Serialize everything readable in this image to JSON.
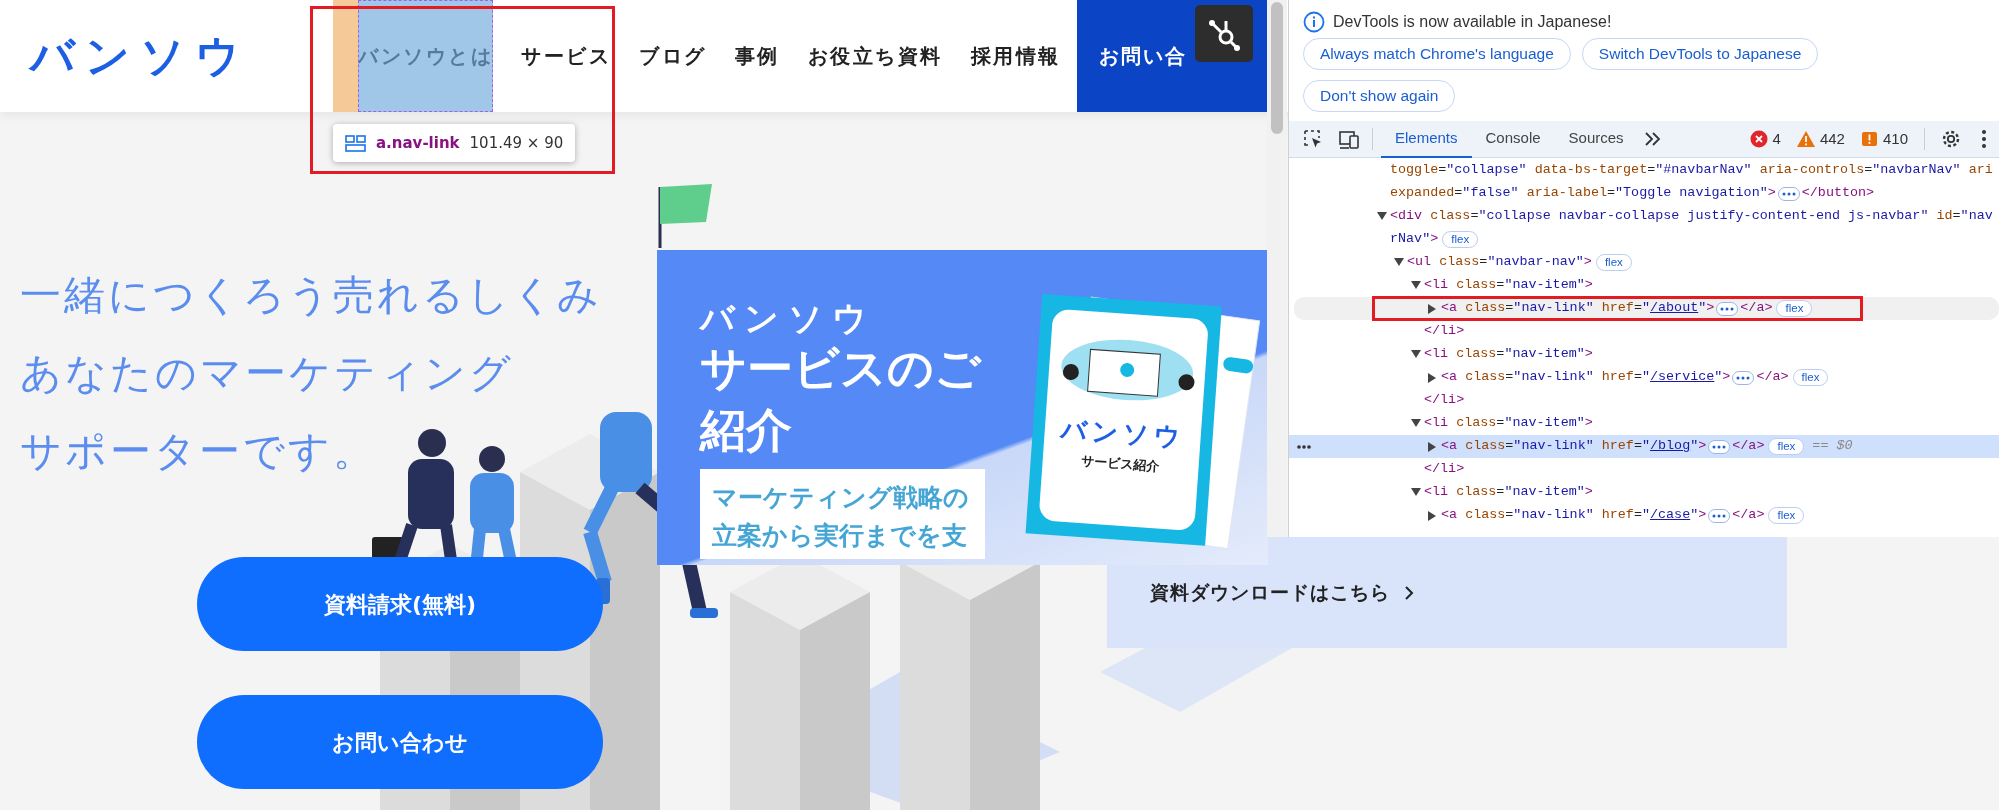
{
  "header": {
    "logo": "バンソウ",
    "nav": [
      {
        "label": "バンソウとは",
        "inspected": true
      },
      {
        "label": "サービス",
        "inspected": false
      },
      {
        "label": "ブログ",
        "inspected": false
      },
      {
        "label": "事例",
        "inspected": false
      },
      {
        "label": "お役立ち資料",
        "inspected": false
      },
      {
        "label": "採用情報",
        "inspected": false
      }
    ],
    "contact_button": "お問い合",
    "inspector_tooltip": {
      "selector": "a.nav-link",
      "size": "101.49 × 90"
    }
  },
  "hero": {
    "headline": [
      "一緒につくろう売れるしくみ",
      "あなたのマーケティング",
      "サポーターです。"
    ],
    "buttons": [
      "資料請求(無料)",
      "お問い合わせ"
    ]
  },
  "promo": {
    "brand": "バンソウ",
    "title": [
      "サービスのご",
      "紹介"
    ],
    "lead": [
      "マーケティング戦略の",
      "立案から実行までを支"
    ],
    "brochure": {
      "brand": "バンソウ",
      "title": "サービス紹介"
    },
    "download_link": "資料ダウンロードはこちら"
  },
  "devtools": {
    "notice": "DevTools is now available in Japanese!",
    "notice_buttons": [
      "Always match Chrome's language",
      "Switch DevTools to Japanese",
      "Don't show again"
    ],
    "tabs": [
      {
        "label": "Elements",
        "selected": true
      },
      {
        "label": "Console",
        "selected": false
      },
      {
        "label": "Sources",
        "selected": false
      }
    ],
    "errors": "4",
    "warnings": "442",
    "issues": "410",
    "dom": [
      {
        "kind": "continuation",
        "lines": [
          "toggle=\"collapse\" data-bs-target=\"#navbarNav\" aria-controls=\"navbarNav\" ari",
          "expanded=\"false\" aria-label=\"Toggle navigation\">"
        ],
        "expanded": false,
        "close": "</button>"
      },
      {
        "kind": "element",
        "lines": [
          "<div class=\"collapse navbar-collapse justify-content-end js-navbar\" id=\"nav",
          "rNav\">"
        ],
        "expanded": true,
        "badge": "flex",
        "children": [
          {
            "kind": "element",
            "lines": [
              "<ul class=\"navbar-nav\">"
            ],
            "expanded": true,
            "badge": "flex",
            "children": [
              {
                "kind": "element",
                "lines": [
                  "<li class=\"nav-item\">"
                ],
                "expanded": true,
                "close": "</li>",
                "children": [
                  {
                    "kind": "link",
                    "before": "<a class=\"nav-link\" href=\"",
                    "link": "/about",
                    "after": "\">",
                    "expanded": false,
                    "close": "</a>",
                    "badge": "flex",
                    "hovered": true,
                    "selected": false,
                    "annotated": true
                  }
                ]
              },
              {
                "kind": "element",
                "lines": [
                  "<li class=\"nav-item\">"
                ],
                "expanded": true,
                "close": "</li>",
                "children": [
                  {
                    "kind": "link",
                    "before": "<a class=\"nav-link\" href=\"",
                    "link": "/service",
                    "after": "\">",
                    "expanded": false,
                    "close": "</a>",
                    "badge": "flex",
                    "hovered": false,
                    "selected": false,
                    "annotated": false
                  }
                ]
              },
              {
                "kind": "element",
                "lines": [
                  "<li class=\"nav-item\">"
                ],
                "expanded": true,
                "close": "</li>",
                "children": [
                  {
                    "kind": "link",
                    "before": "<a class=\"nav-link\" href=\"",
                    "link": "/blog",
                    "after": "\">",
                    "expanded": false,
                    "close": "</a>",
                    "badge": "flex",
                    "hovered": false,
                    "selected": true,
                    "annotated": false,
                    "suffix": "== $0"
                  }
                ]
              },
              {
                "kind": "element",
                "lines": [
                  "<li class=\"nav-item\">"
                ],
                "expanded": true,
                "children": [
                  {
                    "kind": "link",
                    "before": "<a class=\"nav-link\" href=\"",
                    "link": "/case",
                    "after": "\">",
                    "expanded": false,
                    "close": "</a>",
                    "badge": "flex",
                    "hovered": false,
                    "selected": false,
                    "annotated": false
                  }
                ]
              }
            ]
          }
        ]
      }
    ]
  }
}
